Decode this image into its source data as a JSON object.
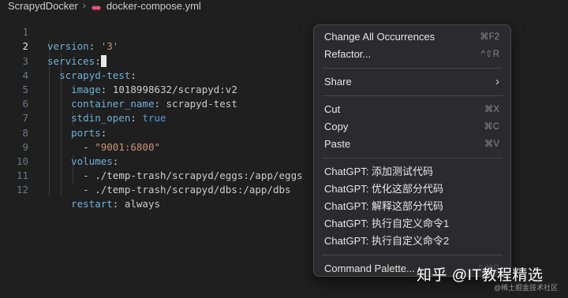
{
  "breadcrumb": {
    "folder": "ScrapydDocker",
    "file": "docker-compose.yml"
  },
  "editor": {
    "lines": [
      {
        "num": "1",
        "key": "version",
        "colon": ": ",
        "value": "'3'"
      },
      {
        "num": "2",
        "key": "services",
        "colon": ":"
      },
      {
        "num": "3",
        "key": "scrapyd-test",
        "colon": ":"
      },
      {
        "num": "4",
        "key": "image",
        "colon": ": ",
        "value": "1018998632/scrapyd:v2"
      },
      {
        "num": "5",
        "key": "container_name",
        "colon": ": ",
        "value": "scrapyd-test"
      },
      {
        "num": "6",
        "key": "stdin_open",
        "colon": ": ",
        "value": "true"
      },
      {
        "num": "7",
        "key": "ports",
        "colon": ":"
      },
      {
        "num": "8",
        "dash": "- ",
        "value": "\"9001:6800\""
      },
      {
        "num": "9",
        "key": "volumes",
        "colon": ":"
      },
      {
        "num": "10",
        "dash": "- ",
        "value": "./temp-trash/scrapyd/eggs:/app/eggs"
      },
      {
        "num": "11",
        "dash": "- ",
        "value": "./temp-trash/scrapyd/dbs:/app/dbs"
      },
      {
        "num": "12",
        "key": "restart",
        "colon": ": ",
        "value": "always"
      }
    ]
  },
  "context_menu": {
    "change_all": {
      "label": "Change All Occurrences",
      "shortcut": "⌘F2"
    },
    "refactor": {
      "label": "Refactor...",
      "shortcut": "^⇧R"
    },
    "share": {
      "label": "Share"
    },
    "cut": {
      "label": "Cut",
      "shortcut": "⌘X"
    },
    "copy": {
      "label": "Copy",
      "shortcut": "⌘C"
    },
    "paste": {
      "label": "Paste",
      "shortcut": "⌘V"
    },
    "chatgpt_1": {
      "label": "ChatGPT: 添加测试代码"
    },
    "chatgpt_2": {
      "label": "ChatGPT: 优化这部分代码"
    },
    "chatgpt_3": {
      "label": "ChatGPT: 解释这部分代码"
    },
    "chatgpt_4": {
      "label": "ChatGPT: 执行自定义命令1"
    },
    "chatgpt_5": {
      "label": "ChatGPT: 执行自定义命令2"
    },
    "command_palette": {
      "label": "Command Palette...",
      "shortcut": "⇧⌘P"
    }
  },
  "watermark": {
    "main": "知乎 @IT教程精选",
    "sub": "@稀土掘金技术社区"
  },
  "colors": {
    "key": "#6fb0d8",
    "string": "#ce9178",
    "bool": "#569cd6",
    "menu_bg": "#2b2b2d"
  }
}
